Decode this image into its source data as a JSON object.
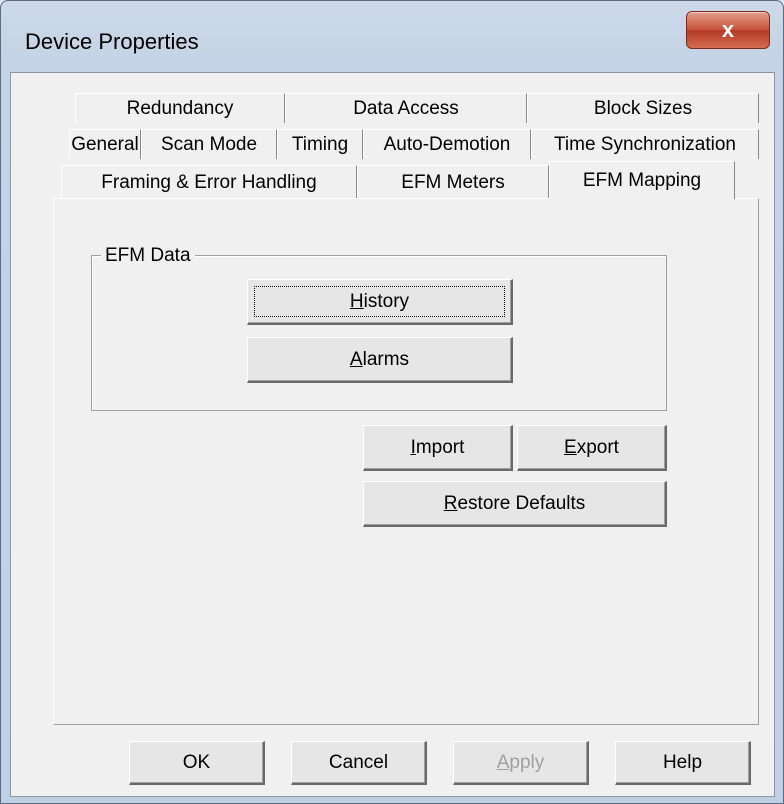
{
  "window": {
    "title": "Device Properties",
    "close_label": "x"
  },
  "tabs": {
    "row1": [
      "Redundancy",
      "Data Access",
      "Block Sizes"
    ],
    "row2": [
      "General",
      "Scan Mode",
      "Timing",
      "Auto-Demotion",
      "Time Synchronization"
    ],
    "row3": [
      "Framing & Error Handling",
      "EFM Meters",
      "EFM Mapping"
    ],
    "active": "EFM Mapping"
  },
  "efm_data": {
    "group_label": "EFM Data",
    "history": {
      "mnemonic": "H",
      "rest": "istory"
    },
    "alarms": {
      "mnemonic": "A",
      "rest": "larms"
    }
  },
  "actions": {
    "import": {
      "mnemonic": "I",
      "rest": "mport"
    },
    "export": {
      "mnemonic": "E",
      "rest": "xport"
    },
    "restore": {
      "mnemonic": "R",
      "rest": "estore Defaults"
    }
  },
  "footer": {
    "ok": "OK",
    "cancel": "Cancel",
    "apply": {
      "mnemonic": "A",
      "rest": "pply"
    },
    "help": "Help"
  }
}
